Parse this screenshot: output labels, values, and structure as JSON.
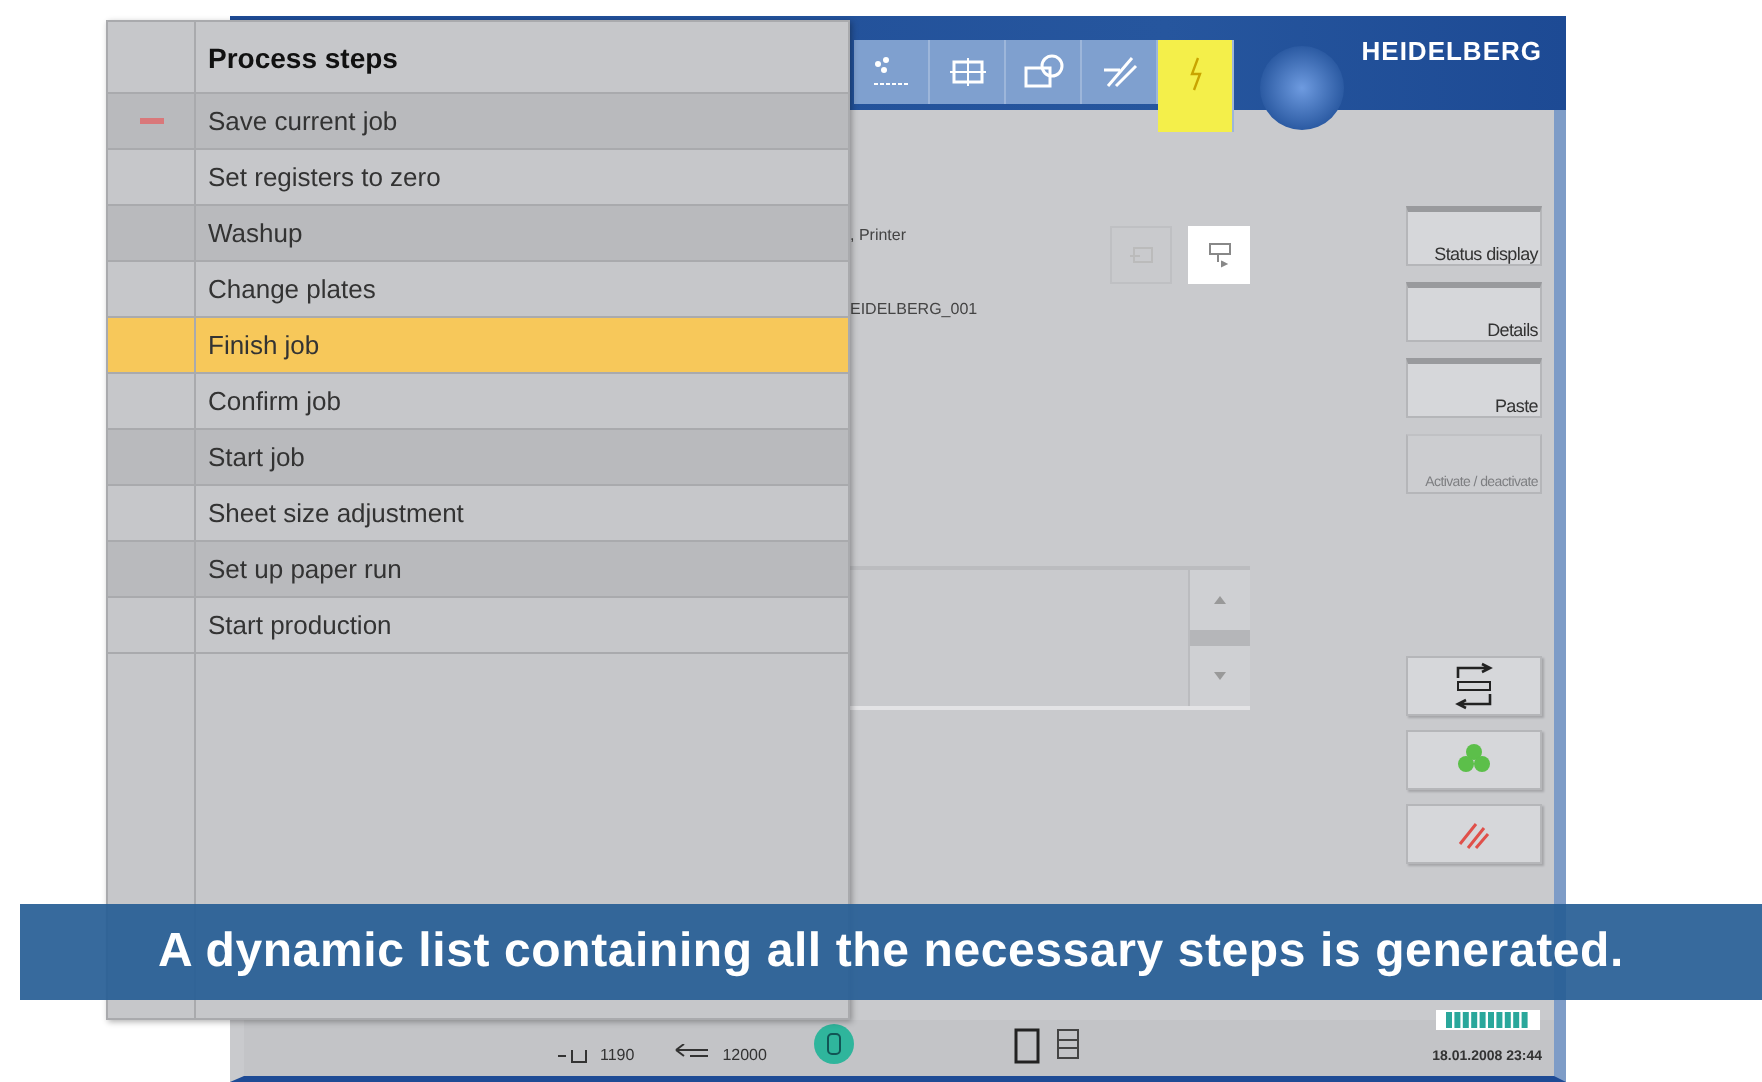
{
  "header": {
    "logo": "HEIDELBERG",
    "tabs": [
      {
        "kind": "wash",
        "selected": false
      },
      {
        "kind": "register",
        "selected": false
      },
      {
        "kind": "plate",
        "selected": false
      },
      {
        "kind": "rollers",
        "selected": false
      },
      {
        "kind": "lightning",
        "selected": true
      }
    ]
  },
  "job": {
    "printer": ", Printer",
    "job_name": "EIDELBERG_001",
    "view_buttons": [
      {
        "kind": "back",
        "selected": false
      },
      {
        "kind": "forward",
        "selected": true
      }
    ]
  },
  "side_buttons": [
    {
      "label": "Status display",
      "disabled": false
    },
    {
      "label": "Details",
      "disabled": false
    },
    {
      "label": "Paste",
      "disabled": false
    },
    {
      "label": "Activate / deactivate",
      "disabled": true
    }
  ],
  "action_buttons": [
    {
      "kind": "swap"
    },
    {
      "kind": "print"
    },
    {
      "kind": "stop"
    }
  ],
  "status_bar": {
    "sheet_size": "1190",
    "counter": "12000",
    "datetime": "18.01.2008 23:44"
  },
  "process_steps": {
    "title": "Process steps",
    "items": [
      {
        "label": "Save current job",
        "marked": true,
        "selected": false
      },
      {
        "label": "Set registers to zero",
        "marked": false,
        "selected": false
      },
      {
        "label": "Washup",
        "marked": false,
        "selected": false
      },
      {
        "label": "Change plates",
        "marked": false,
        "selected": false
      },
      {
        "label": "Finish job",
        "marked": false,
        "selected": true
      },
      {
        "label": "Confirm job",
        "marked": false,
        "selected": false
      },
      {
        "label": "Start job",
        "marked": false,
        "selected": false
      },
      {
        "label": "Sheet size adjustment",
        "marked": false,
        "selected": false
      },
      {
        "label": "Set up paper run",
        "marked": false,
        "selected": false
      },
      {
        "label": "Start production",
        "marked": false,
        "selected": false
      }
    ]
  },
  "caption": "A dynamic list containing all the necessary steps is generated."
}
